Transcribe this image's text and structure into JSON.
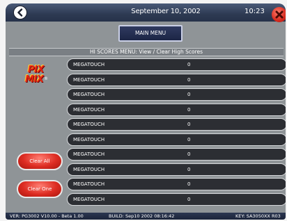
{
  "header": {
    "date": "September 10, 2002",
    "time": "10:23"
  },
  "nav": {
    "main_menu_label": "MAIN MENU"
  },
  "menu_title": "HI SCORES MENU: View / Clear High Scores",
  "logo": {
    "line1": "PIX",
    "line2": "MIX",
    "mark": "®"
  },
  "scores": [
    {
      "name": "MEGATOUCH",
      "score": "0"
    },
    {
      "name": "MEGATOUCH",
      "score": "0"
    },
    {
      "name": "MEGATOUCH",
      "score": "0"
    },
    {
      "name": "MEGATOUCH",
      "score": "0"
    },
    {
      "name": "MEGATOUCH",
      "score": "0"
    },
    {
      "name": "MEGATOUCH",
      "score": "0"
    },
    {
      "name": "MEGATOUCH",
      "score": "0"
    },
    {
      "name": "MEGATOUCH",
      "score": "0"
    },
    {
      "name": "MEGATOUCH",
      "score": "0"
    },
    {
      "name": "MEGATOUCH",
      "score": "0"
    }
  ],
  "buttons": {
    "clear_all": "Clear All",
    "clear_one": "Clear One"
  },
  "footer": {
    "version": "VER: PG3002 V10.00 - Beta 1.00",
    "build": "BUILD: Sep10 2002 08:16:42",
    "key": "KEY: SA3050XX R03"
  },
  "icons": {
    "back": "back-arrow-icon",
    "close": "close-x-icon"
  },
  "colors": {
    "topbar": "#2d3a52",
    "panel": "#8f9497",
    "row": "#2c2e33",
    "accent_red": "#dd2c22"
  }
}
